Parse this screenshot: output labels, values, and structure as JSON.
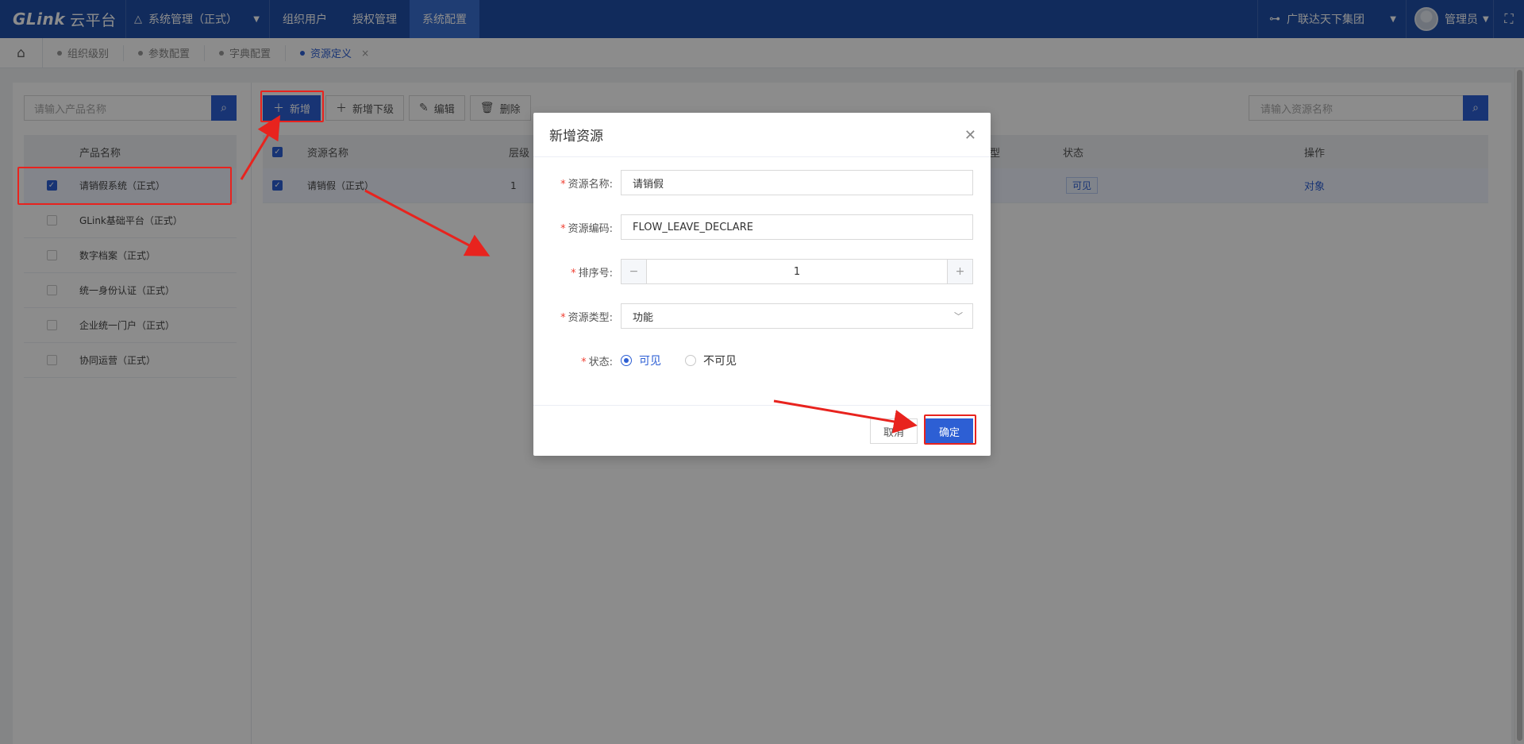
{
  "topbar": {
    "logo_main": "GLink",
    "logo_sub": "云平台",
    "system_select": "系统管理（正式）",
    "nav": [
      {
        "label": "组织用户"
      },
      {
        "label": "授权管理"
      },
      {
        "label": "系统配置",
        "active": true
      }
    ],
    "org_select": "广联达天下集团",
    "user_name": "管理员"
  },
  "tabs": [
    {
      "label": "组织级别"
    },
    {
      "label": "参数配置"
    },
    {
      "label": "字典配置"
    },
    {
      "label": "资源定义",
      "active": true
    }
  ],
  "left_panel": {
    "search_placeholder": "请输入产品名称",
    "header": "产品名称",
    "rows": [
      {
        "name": "请销假系统（正式）",
        "checked": true
      },
      {
        "name": "GLink基础平台（正式）",
        "checked": false
      },
      {
        "name": "数字档案（正式）",
        "checked": false
      },
      {
        "name": "统一身份认证（正式）",
        "checked": false
      },
      {
        "name": "企业统一门户（正式）",
        "checked": false
      },
      {
        "name": "协同运营（正式）",
        "checked": false
      }
    ]
  },
  "toolbar": {
    "add": "新增",
    "add_child": "新增下级",
    "edit": "编辑",
    "delete": "删除"
  },
  "right_panel": {
    "search_placeholder": "请输入资源名称",
    "columns": {
      "name": "资源名称",
      "level": "层级",
      "type_partial": "型",
      "status": "状态",
      "ops": "操作"
    },
    "rows": [
      {
        "name": "请销假（正式）",
        "level": "1",
        "status": "可见",
        "op": "对象",
        "checked": true
      }
    ]
  },
  "modal": {
    "title": "新增资源",
    "fields": {
      "name_label": "资源名称:",
      "name_value": "请销假",
      "code_label": "资源编码:",
      "code_value": "FLOW_LEAVE_DECLARE",
      "order_label": "排序号:",
      "order_value": "1",
      "type_label": "资源类型:",
      "type_value": "功能",
      "status_label": "状态:",
      "status_options": [
        "可见",
        "不可见"
      ],
      "status_selected": "可见"
    },
    "cancel": "取消",
    "ok": "确定"
  },
  "colors": {
    "primary": "#2d5fd4",
    "topbar": "#1f4fa8",
    "annotation": "#e8231e"
  }
}
